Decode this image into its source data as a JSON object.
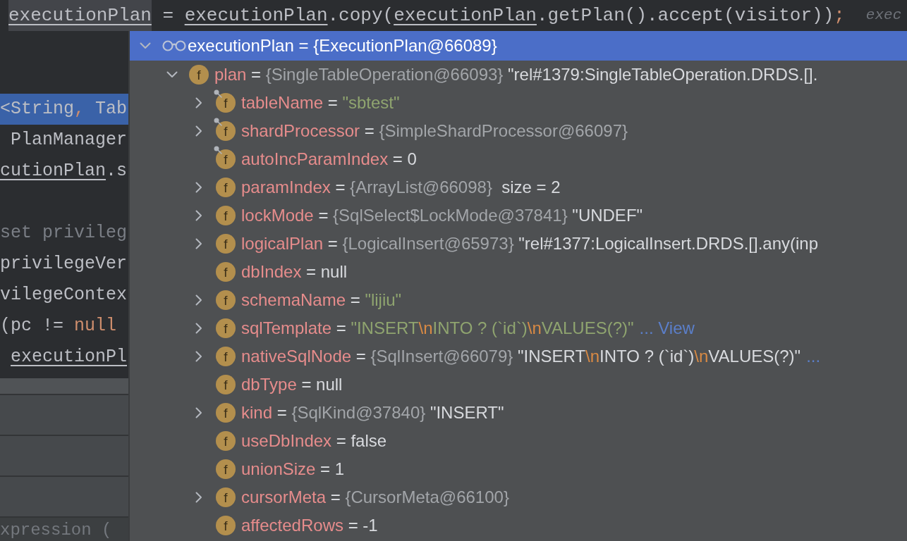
{
  "editor": {
    "top_line": {
      "tokens": [
        {
          "kind": "usage",
          "text": "executionPlan"
        },
        {
          "kind": "text",
          "text": " = "
        },
        {
          "kind": "underlined",
          "text": "executionPlan"
        },
        {
          "kind": "text",
          "text": ".copy("
        },
        {
          "kind": "underlined",
          "text": "executionPlan"
        },
        {
          "kind": "text",
          "text": ".getPlan().accept(visitor))"
        },
        {
          "kind": "orange",
          "text": ";"
        }
      ],
      "hint": "exec"
    },
    "code_blocks": [
      [
        {
          "selected": true,
          "tokens": [
            {
              "kind": "text",
              "text": "<String"
            },
            {
              "kind": "orange",
              "text": ","
            },
            {
              "kind": "text",
              "text": " Tab"
            }
          ]
        },
        {
          "selected": false,
          "tokens": [
            {
              "kind": "text",
              "text": " PlanManager"
            }
          ]
        },
        {
          "selected": false,
          "tokens": [
            {
              "kind": "underlined",
              "text": "cutionPlan"
            },
            {
              "kind": "text",
              "text": ".s"
            }
          ]
        }
      ],
      [
        {
          "selected": false,
          "tokens": [
            {
              "kind": "comment",
              "text": "set privileg"
            }
          ]
        },
        {
          "selected": false,
          "tokens": [
            {
              "kind": "text",
              "text": "privilegeVer"
            }
          ]
        },
        {
          "selected": false,
          "tokens": [
            {
              "kind": "text",
              "text": "vilegeContex"
            }
          ]
        },
        {
          "selected": false,
          "tokens": [
            {
              "kind": "text",
              "text": "(pc != "
            },
            {
              "kind": "orange",
              "text": "null"
            }
          ]
        },
        {
          "selected": false,
          "tokens": [
            {
              "kind": "underlined",
              "text": " executionPl"
            }
          ]
        }
      ]
    ]
  },
  "tool_panel": {
    "expression": {
      "placeholder": "xpression ("
    }
  },
  "debug_popup": {
    "root": {
      "kind": "watch",
      "name": "executionPlan",
      "selected": true,
      "expanded": true,
      "value": " = {ExecutionPlan@66089}",
      "children": [
        {
          "kind": "field",
          "icon_letter": "f",
          "name": "plan",
          "selected": false,
          "expanded": true,
          "final": false,
          "value": [
            {
              "kind": "op",
              "text": " = "
            },
            {
              "kind": "type",
              "text": "{SingleTableOperation@66093}"
            },
            {
              "kind": "text",
              "text": " \"rel#1379:SingleTableOperation.DRDS.[]."
            }
          ],
          "children": [
            {
              "kind": "field",
              "icon_letter": "f",
              "name": "tableName",
              "selected": false,
              "expanded": false,
              "final": true,
              "value": [
                {
                  "kind": "op",
                  "text": " = "
                },
                {
                  "kind": "string",
                  "text": "\"sbtest\""
                }
              ]
            },
            {
              "kind": "field",
              "icon_letter": "f",
              "name": "shardProcessor",
              "selected": false,
              "expanded": false,
              "final": true,
              "value": [
                {
                  "kind": "op",
                  "text": " = "
                },
                {
                  "kind": "type",
                  "text": "{SimpleShardProcessor@66097}"
                }
              ]
            },
            {
              "kind": "field",
              "icon_letter": "f",
              "name": "autoIncParamIndex",
              "selected": false,
              "final": true,
              "value": [
                {
                  "kind": "op",
                  "text": " = "
                },
                {
                  "kind": "text",
                  "text": "0"
                }
              ]
            },
            {
              "kind": "field",
              "icon_letter": "f",
              "name": "paramIndex",
              "selected": false,
              "expanded": false,
              "final": false,
              "value": [
                {
                  "kind": "op",
                  "text": " = "
                },
                {
                  "kind": "type",
                  "text": "{ArrayList@66098}"
                },
                {
                  "kind": "text",
                  "text": "  size = 2"
                }
              ]
            },
            {
              "kind": "field",
              "icon_letter": "f",
              "name": "lockMode",
              "selected": false,
              "expanded": false,
              "final": false,
              "value": [
                {
                  "kind": "op",
                  "text": " = "
                },
                {
                  "kind": "type",
                  "text": "{SqlSelect$LockMode@37841}"
                },
                {
                  "kind": "text",
                  "text": " \"UNDEF\""
                }
              ]
            },
            {
              "kind": "field",
              "icon_letter": "f",
              "name": "logicalPlan",
              "selected": false,
              "expanded": false,
              "final": false,
              "value": [
                {
                  "kind": "op",
                  "text": " = "
                },
                {
                  "kind": "type",
                  "text": "{LogicalInsert@65973}"
                },
                {
                  "kind": "text",
                  "text": " \"rel#1377:LogicalInsert.DRDS.[].any(inp"
                }
              ]
            },
            {
              "kind": "field",
              "icon_letter": "f",
              "name": "dbIndex",
              "selected": false,
              "final": false,
              "value": [
                {
                  "kind": "op",
                  "text": " = "
                },
                {
                  "kind": "text",
                  "text": "null"
                }
              ]
            },
            {
              "kind": "field",
              "icon_letter": "f",
              "name": "schemaName",
              "selected": false,
              "expanded": false,
              "final": false,
              "value": [
                {
                  "kind": "op",
                  "text": " = "
                },
                {
                  "kind": "string",
                  "text": "\"lijiu\""
                }
              ]
            },
            {
              "kind": "field",
              "icon_letter": "f",
              "name": "sqlTemplate",
              "selected": false,
              "expanded": false,
              "final": false,
              "value": [
                {
                  "kind": "op",
                  "text": " = "
                },
                {
                  "kind": "string",
                  "text": "\"INSERT"
                },
                {
                  "kind": "escape",
                  "text": "\\n"
                },
                {
                  "kind": "string",
                  "text": "INTO ? (`id`)"
                },
                {
                  "kind": "escape",
                  "text": "\\n"
                },
                {
                  "kind": "string",
                  "text": "VALUES(?)\""
                },
                {
                  "kind": "link",
                  "text": "... View"
                }
              ]
            },
            {
              "kind": "field",
              "icon_letter": "f",
              "name": "nativeSqlNode",
              "selected": false,
              "expanded": false,
              "final": false,
              "value": [
                {
                  "kind": "op",
                  "text": " = "
                },
                {
                  "kind": "type",
                  "text": "{SqlInsert@66079}"
                },
                {
                  "kind": "text",
                  "text": " \"INSERT"
                },
                {
                  "kind": "escape",
                  "text": "\\n"
                },
                {
                  "kind": "text",
                  "text": "INTO ? (`id`)"
                },
                {
                  "kind": "escape",
                  "text": "\\n"
                },
                {
                  "kind": "text",
                  "text": "VALUES(?)\""
                },
                {
                  "kind": "link",
                  "text": "..."
                }
              ]
            },
            {
              "kind": "field",
              "icon_letter": "f",
              "name": "dbType",
              "selected": false,
              "final": false,
              "value": [
                {
                  "kind": "op",
                  "text": " = "
                },
                {
                  "kind": "text",
                  "text": "null"
                }
              ]
            },
            {
              "kind": "field",
              "icon_letter": "f",
              "name": "kind",
              "selected": false,
              "expanded": false,
              "final": false,
              "value": [
                {
                  "kind": "op",
                  "text": " = "
                },
                {
                  "kind": "type",
                  "text": "{SqlKind@37840}"
                },
                {
                  "kind": "text",
                  "text": " \"INSERT\""
                }
              ]
            },
            {
              "kind": "field",
              "icon_letter": "f",
              "name": "useDbIndex",
              "selected": false,
              "final": false,
              "value": [
                {
                  "kind": "op",
                  "text": " = "
                },
                {
                  "kind": "text",
                  "text": "false"
                }
              ]
            },
            {
              "kind": "field",
              "icon_letter": "f",
              "name": "unionSize",
              "selected": false,
              "final": false,
              "value": [
                {
                  "kind": "op",
                  "text": " = "
                },
                {
                  "kind": "text",
                  "text": "1"
                }
              ]
            },
            {
              "kind": "field",
              "icon_letter": "f",
              "name": "cursorMeta",
              "selected": false,
              "expanded": false,
              "final": false,
              "value": [
                {
                  "kind": "op",
                  "text": " = "
                },
                {
                  "kind": "type",
                  "text": "{CursorMeta@66100}"
                }
              ]
            },
            {
              "kind": "field",
              "icon_letter": "f",
              "name": "affectedRows",
              "selected": false,
              "final": false,
              "value": [
                {
                  "kind": "op",
                  "text": " = "
                },
                {
                  "kind": "text",
                  "text": "-1"
                }
              ]
            }
          ]
        }
      ]
    }
  }
}
